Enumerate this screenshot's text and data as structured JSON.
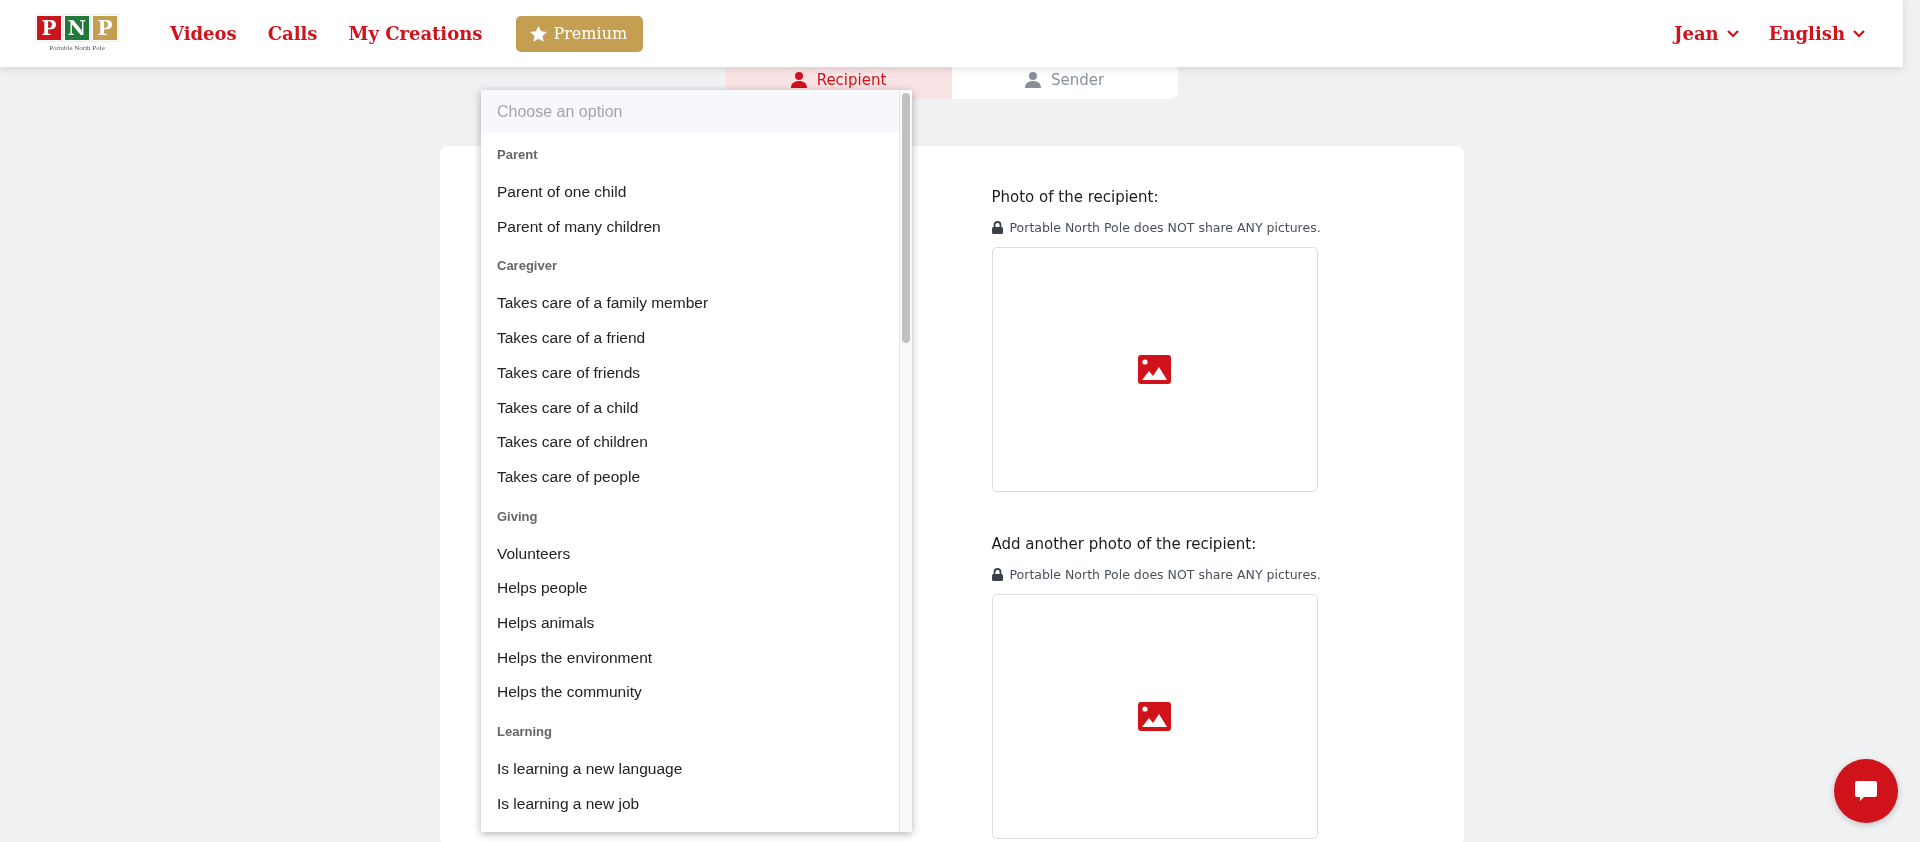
{
  "header": {
    "logo": {
      "letters": [
        "P",
        "N",
        "P"
      ],
      "tagline": "Portable North Pole"
    },
    "nav": [
      {
        "label": "Videos"
      },
      {
        "label": "Calls"
      },
      {
        "label": "My Creations"
      }
    ],
    "premium": "Premium",
    "user_menu": "Jean",
    "language_menu": "English"
  },
  "tabs": [
    {
      "label": "Recipient",
      "selected": true
    },
    {
      "label": "Sender",
      "selected": false
    }
  ],
  "dropdown": {
    "placeholder": "Choose an option",
    "groups": [
      {
        "label": "Parent",
        "options": [
          "Parent of one child",
          "Parent of many children"
        ]
      },
      {
        "label": "Caregiver",
        "options": [
          "Takes care of a family member",
          "Takes care of a friend",
          "Takes care of friends",
          "Takes care of a child",
          "Takes care of children",
          "Takes care of people"
        ]
      },
      {
        "label": "Giving",
        "options": [
          "Volunteers",
          "Helps people",
          "Helps animals",
          "Helps the environment",
          "Helps the community"
        ]
      },
      {
        "label": "Learning",
        "options": [
          "Is learning a new language",
          "Is learning a new job"
        ]
      }
    ]
  },
  "photo_fields": [
    {
      "label": "Photo of the recipient:",
      "privacy_note": "Portable North Pole does NOT share ANY pictures."
    },
    {
      "label": "Add another photo of the recipient:",
      "privacy_note": "Portable North Pole does NOT share ANY pictures."
    }
  ]
}
